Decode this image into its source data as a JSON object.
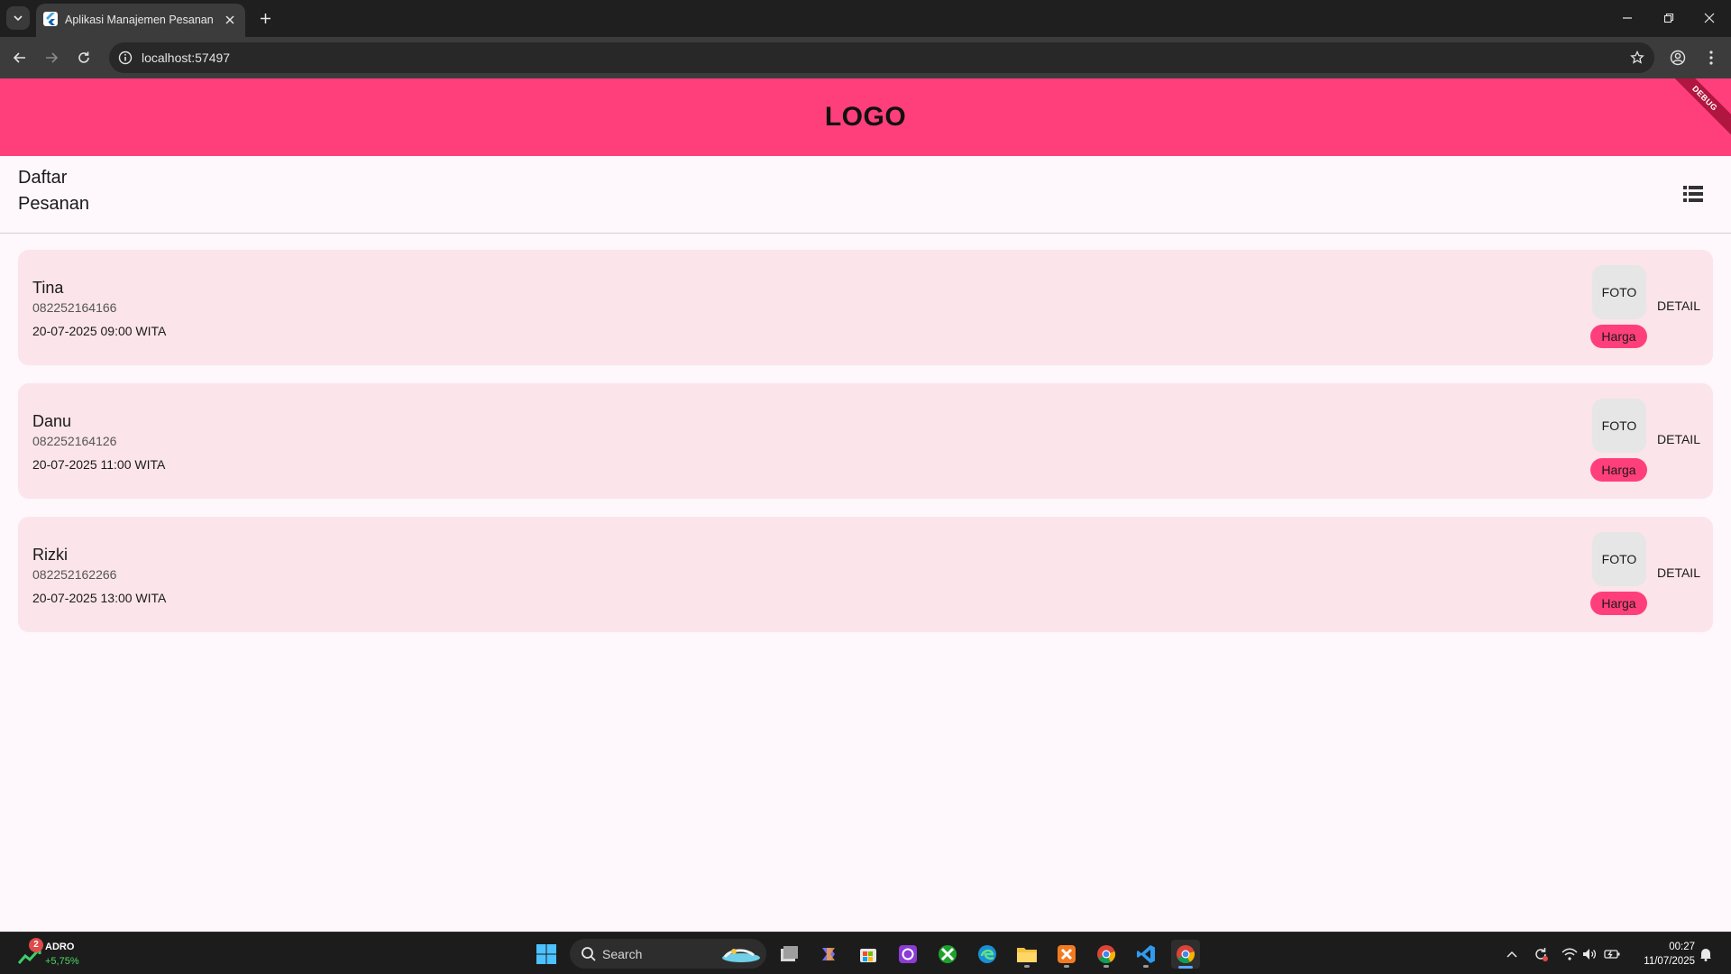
{
  "browser": {
    "tab_title": "Aplikasi Manajemen Pesanan",
    "url": "localhost:57497"
  },
  "app": {
    "logo": "LOGO",
    "debug_banner": "DEBUG",
    "page_title": "Daftar Pesanan",
    "orders": [
      {
        "name": "Tina",
        "phone": "082252164166",
        "datetime": "20-07-2025 09:00 WITA",
        "foto_label": "FOTO",
        "harga_label": "Harga",
        "detail_label": "DETAIL"
      },
      {
        "name": "Danu",
        "phone": "082252164126",
        "datetime": "20-07-2025 11:00 WITA",
        "foto_label": "FOTO",
        "harga_label": "Harga",
        "detail_label": "DETAIL"
      },
      {
        "name": "Rizki",
        "phone": "082252162266",
        "datetime": "20-07-2025 13:00 WITA",
        "foto_label": "FOTO",
        "harga_label": "Harga",
        "detail_label": "DETAIL"
      }
    ],
    "colors": {
      "primary": "#ff3f7b",
      "card": "#fbe4ea",
      "background": "#fef7fc"
    }
  },
  "taskbar": {
    "widget": {
      "badge": "2",
      "ticker": "ADRO",
      "change": "+5,75%"
    },
    "search_label": "Search",
    "clock": {
      "time": "00:27",
      "date": "11/07/2025"
    },
    "apps": [
      "file-explorer-icon",
      "copilot-icon",
      "ms-store-icon",
      "app-icon",
      "xbox-icon",
      "edge-icon",
      "folder-icon",
      "xampp-icon",
      "chrome-icon",
      "vscode-icon",
      "chrome-active-icon"
    ]
  }
}
